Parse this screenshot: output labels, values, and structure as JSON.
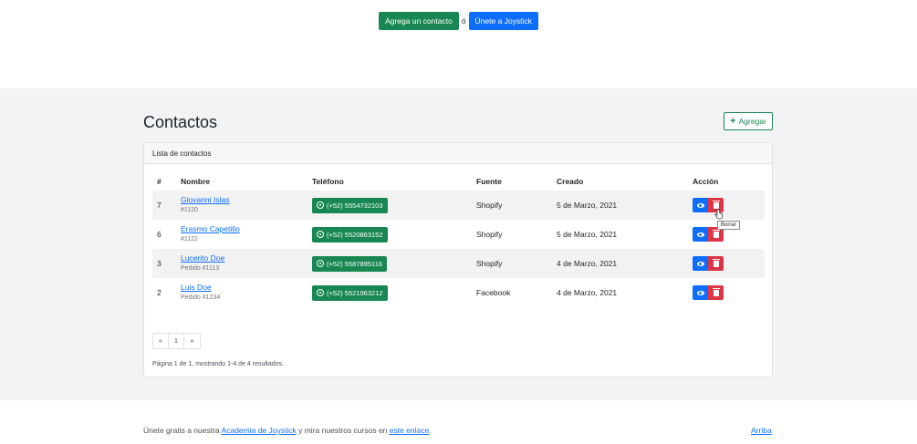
{
  "top": {
    "add_contact_label": "Agrega un contacto",
    "separator": "ó",
    "join_label": "Únete a Joystick"
  },
  "page": {
    "title": "Contactos",
    "add_label": "Agregar"
  },
  "card": {
    "header": "Lista de contactos"
  },
  "table": {
    "headers": {
      "num": "#",
      "name": "Nombre",
      "phone": "Teléfono",
      "source": "Fuente",
      "created": "Creado",
      "action": "Acción"
    },
    "rows": [
      {
        "num": "7",
        "name": "Giovanni Islas",
        "order": "#1120",
        "phone": "(+52) 5554732103",
        "source": "Shopify",
        "created": "5 de Marzo, 2021"
      },
      {
        "num": "6",
        "name": "Erasmo Capetillo",
        "order": "#1122",
        "phone": "(+52) 5520863152",
        "source": "Shopify",
        "created": "5 de Marzo, 2021"
      },
      {
        "num": "3",
        "name": "Lucerito Doe",
        "order": "Pedido #1113",
        "phone": "(+52) 5587895116",
        "source": "Shopify",
        "created": "4 de Marzo, 2021"
      },
      {
        "num": "2",
        "name": "Luis Doe",
        "order": "Pedido #1234",
        "phone": "(+52) 5521963212",
        "source": "Facebook",
        "created": "4 de Marzo, 2021"
      }
    ]
  },
  "tooltip": "Borrar",
  "pagination": {
    "prev": "«",
    "current": "1",
    "next": "»",
    "info": "Página 1 de 1, mostrando 1-4 de 4 resultados."
  },
  "footer": {
    "text_before": "Únete gratis a nuestra ",
    "academy_link": "Academia de Joystick",
    "text_middle": " y mira nuestros cursos en ",
    "courses_link": "este enlace",
    "text_after": ".",
    "top_link": "Arriba"
  },
  "colors": {
    "primary": "#0d6efd",
    "success": "#198754",
    "danger": "#dc3545",
    "section_bg": "#f1f3f5"
  }
}
